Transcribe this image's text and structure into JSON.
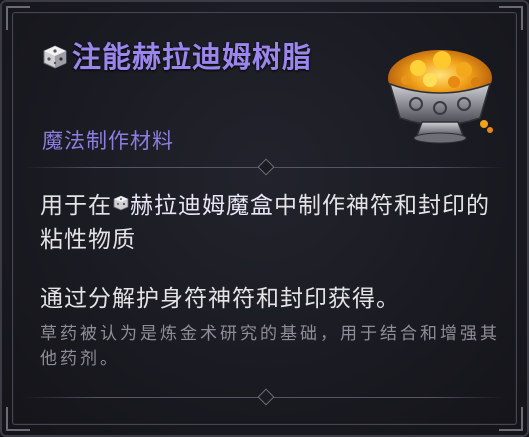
{
  "item": {
    "name": "注能赫拉迪姆树脂",
    "category": "魔法制作材料",
    "description_prefix": "用于在",
    "description_link": "赫拉迪姆魔盒",
    "description_suffix": "中制作神符和封印的粘性物质",
    "source": "通过分解护身符神符和封印获得。",
    "flavor": "草药被认为是炼金术研究的基础，用于结合和增强其他药剂。"
  },
  "colors": {
    "title": "#9b86ee",
    "category": "#8c7de0",
    "body_text": "#e4e4e6",
    "flavor_text": "#8f8e98",
    "background": "#1a1b22",
    "border": "#45464f",
    "resin_gold": "#f2a21a",
    "bowl_silver": "#9a9aa2"
  },
  "icons": {
    "title_icon": "horadric-cube-icon",
    "inline_icon": "horadric-cube-small-icon",
    "item_art": "resin-bowl-icon"
  }
}
